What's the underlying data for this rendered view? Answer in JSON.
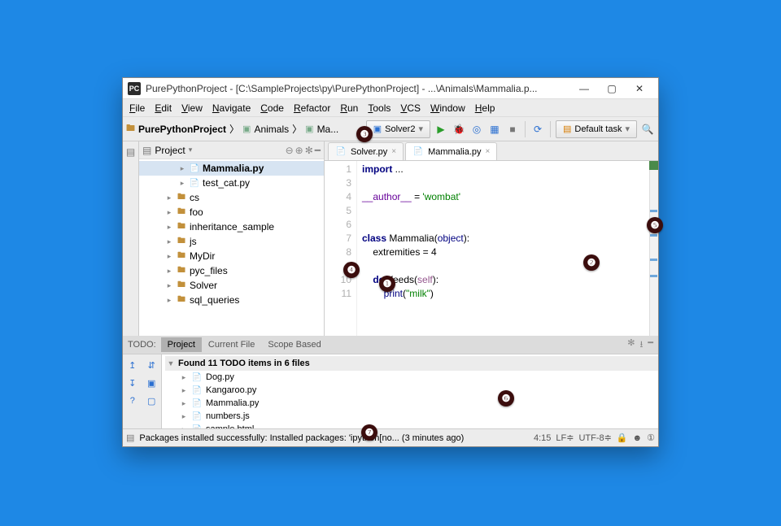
{
  "window": {
    "title": "PurePythonProject - [C:\\SampleProjects\\py\\PurePythonProject] - ...\\Animals\\Mammalia.p...",
    "app_badge": "PC"
  },
  "menu": [
    "File",
    "Edit",
    "View",
    "Navigate",
    "Code",
    "Refactor",
    "Run",
    "Tools",
    "VCS",
    "Window",
    "Help"
  ],
  "breadcrumbs": {
    "root": "PurePythonProject",
    "pkg": "Animals",
    "file": "Ma..."
  },
  "toolbar": {
    "run_config": "Solver2",
    "task": "Default task"
  },
  "project_panel": {
    "title": "Project",
    "tree": [
      {
        "kind": "py",
        "name": "Mammalia.py",
        "depth": 3,
        "sel": true,
        "bold": true
      },
      {
        "kind": "py",
        "name": "test_cat.py",
        "depth": 3
      },
      {
        "kind": "dir",
        "name": "cs",
        "depth": 2
      },
      {
        "kind": "dir",
        "name": "foo",
        "depth": 2
      },
      {
        "kind": "dir",
        "name": "inheritance_sample",
        "depth": 2
      },
      {
        "kind": "dir",
        "name": "js",
        "depth": 2
      },
      {
        "kind": "dir",
        "name": "MyDir",
        "depth": 2
      },
      {
        "kind": "dir",
        "name": "pyc_files",
        "depth": 2
      },
      {
        "kind": "dir",
        "name": "Solver",
        "depth": 2
      },
      {
        "kind": "dir",
        "name": "sql_queries",
        "depth": 2
      }
    ]
  },
  "editor": {
    "tabs": [
      {
        "name": "Solver.py",
        "active": false
      },
      {
        "name": "Mammalia.py",
        "active": true
      }
    ],
    "gutter": [
      "1",
      "3",
      "4",
      "5",
      "6",
      "7",
      "8",
      "9",
      "10",
      "11"
    ],
    "lines": [
      {
        "html": "<span class='kw'>import</span> ..."
      },
      {
        "html": ""
      },
      {
        "html": "<span class='dund'>__author__</span> = <span class='str'>'wombat'</span>"
      },
      {
        "html": ""
      },
      {
        "html": ""
      },
      {
        "html": "<span class='kw'>class</span> Mammalia(<span class='builtin'>object</span>):"
      },
      {
        "html": "    extremities = 4"
      },
      {
        "html": ""
      },
      {
        "html": "    <span class='def'>def</span> feeds(<span class='self'>self</span>):"
      },
      {
        "html": "        <span class='builtin'>print</span>(<span class='str'>\"milk\"</span>)"
      }
    ]
  },
  "todo": {
    "label": "TODO:",
    "tabs": [
      "Project",
      "Current File",
      "Scope Based"
    ],
    "header": "Found 11 TODO items in 6 files",
    "items": [
      {
        "icon": "py",
        "name": "Dog.py"
      },
      {
        "icon": "py",
        "name": "Kangaroo.py"
      },
      {
        "icon": "py",
        "name": "Mammalia.py"
      },
      {
        "icon": "js",
        "name": "numbers.js"
      },
      {
        "icon": "html",
        "name": "sample.html"
      }
    ]
  },
  "status": {
    "message": "Packages installed successfully: Installed packages: 'ipython[no... (3 minutes ago)",
    "pos": "4:15",
    "lf": "LF",
    "enc": "UTF-8"
  },
  "callouts": {
    "1": "❶",
    "2": "❷",
    "3": "❸",
    "4": "❹",
    "5": "❺",
    "6": "❻",
    "7": "❼"
  }
}
